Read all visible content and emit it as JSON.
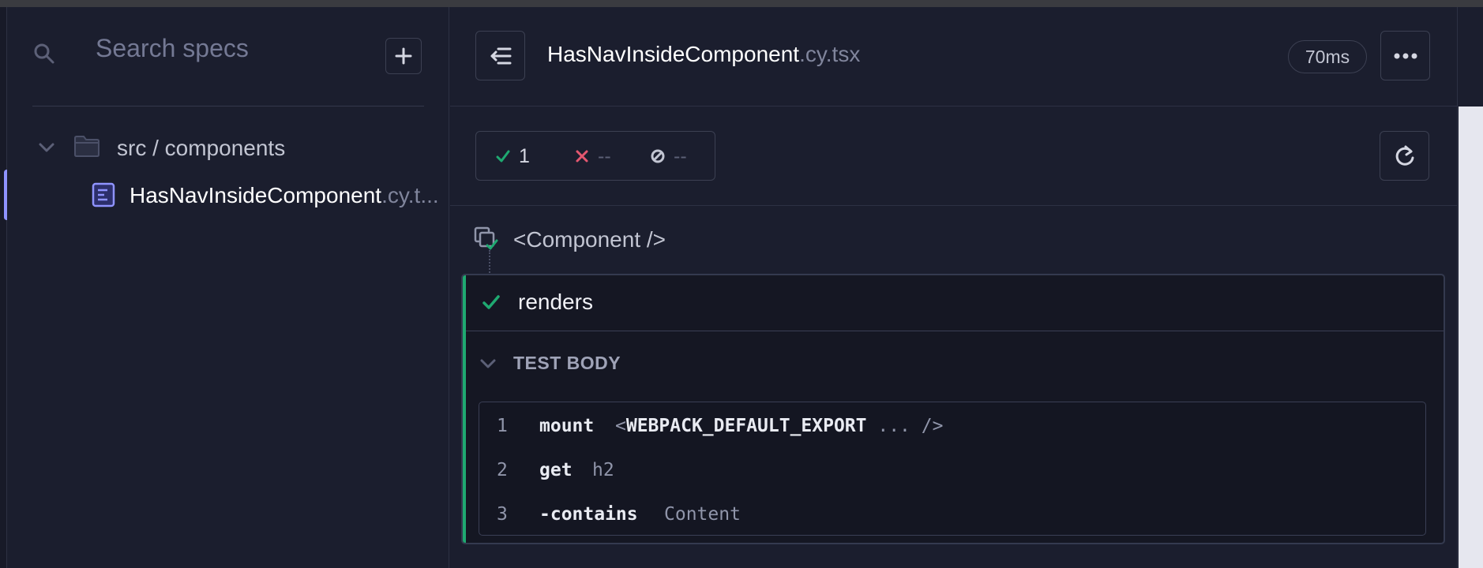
{
  "sidebar": {
    "search_placeholder": "Search specs",
    "add_label": "+",
    "folder": "src / components",
    "file": {
      "name": "HasNavInsideComponent",
      "ext": ".cy.t..."
    }
  },
  "header": {
    "spec_name": "HasNavInsideComponent",
    "spec_ext": ".cy.tsx",
    "duration": "70ms"
  },
  "stats": {
    "passed": "1",
    "failed": "--",
    "pending": "--"
  },
  "colors": {
    "passed": "#1fa971",
    "failed": "#e45770",
    "accent": "#8f93ff"
  },
  "suite": {
    "title": "<Component />"
  },
  "test": {
    "title": "renders",
    "section": "TEST BODY",
    "commands": [
      {
        "num": "1",
        "name": "mount",
        "message_prefix": "<",
        "message_bold": "WEBPACK_DEFAULT_EXPORT",
        "message_suffix": " ... />"
      },
      {
        "num": "2",
        "name": "get",
        "message": "h2"
      },
      {
        "num": "3",
        "name": "-contains",
        "message": "Content"
      }
    ]
  }
}
